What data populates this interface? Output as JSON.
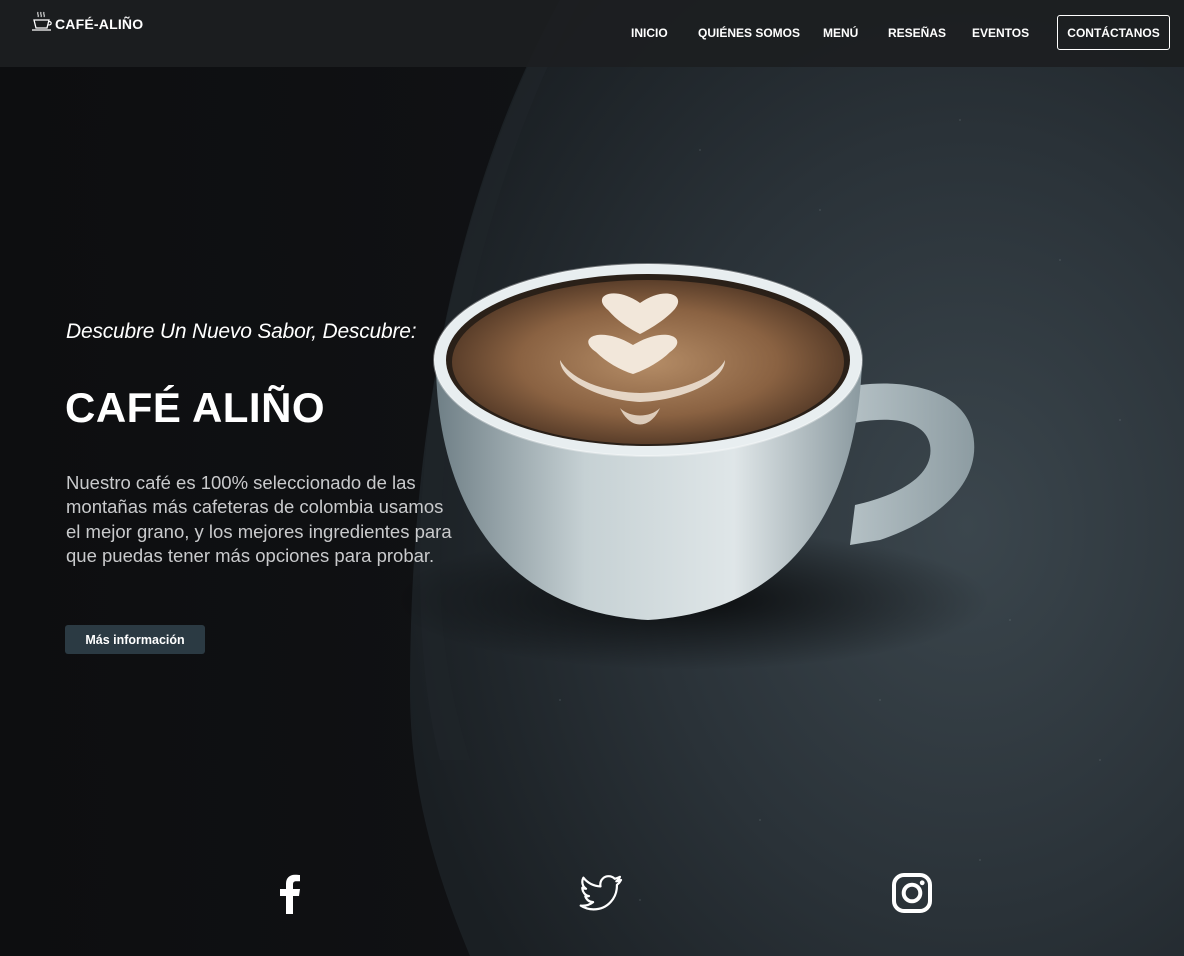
{
  "brand": {
    "name": "CAFÉ-ALIÑO",
    "icon": "coffee-cup-icon"
  },
  "nav": {
    "items": [
      {
        "label": "INICIO"
      },
      {
        "label": "QUIÉNES SOMOS"
      },
      {
        "label": "MENÚ"
      },
      {
        "label": "RESEÑAS"
      },
      {
        "label": "EVENTOS"
      }
    ],
    "contact_label": "CONTÁCTANOS"
  },
  "hero": {
    "tagline": "Descubre Un Nuevo Sabor, Descubre:",
    "title": "CAFÉ ALIÑO",
    "description": "Nuestro café es 100% seleccionado de las montañas más cafeteras de colombia usamos el mejor grano, y los mejores ingredientes para que puedas tener más opciones para probar.",
    "button_label": "Más información",
    "image": "latte-art-cup-on-dark-table"
  },
  "social": [
    {
      "name": "facebook",
      "icon": "facebook-icon"
    },
    {
      "name": "twitter",
      "icon": "twitter-icon"
    },
    {
      "name": "instagram",
      "icon": "instagram-icon"
    }
  ],
  "colors": {
    "nav_bg": "#1c1e21",
    "background": "#0f1012",
    "button_bg": "#2b3a43",
    "text": "#ffffff",
    "body_text": "#c9cacc",
    "coffee": "#7a5334",
    "cup": "#cfd8da"
  }
}
